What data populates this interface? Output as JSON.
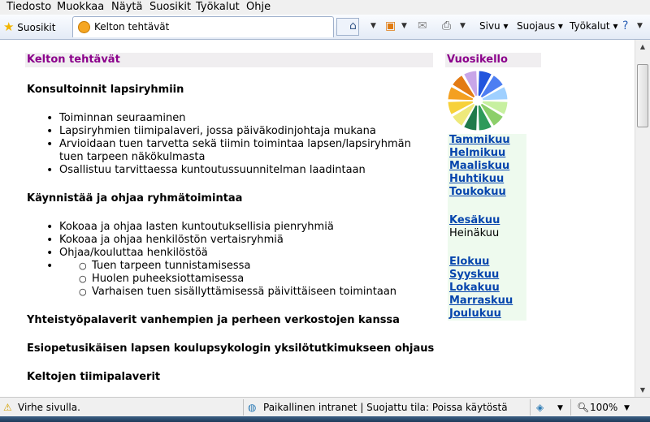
{
  "menu": [
    "Tiedosto",
    "Muokkaa",
    "Näytä",
    "Suosikit",
    "Työkalut",
    "Ohje"
  ],
  "toolbar": {
    "favorites_label": "Suosikit",
    "tab_title": "Kelton tehtävät",
    "page_label": "Sivu",
    "security_label": "Suojaus",
    "tools_label": "Työkalut",
    "icons": [
      "home-icon",
      "rss-icon",
      "mail-icon",
      "print-icon",
      "help-icon"
    ]
  },
  "page": {
    "title": "Kelton tehtävät",
    "sections": [
      {
        "heading": "Konsultoinnit lapsiryhmiin",
        "items": [
          "Toiminnan seuraaminen",
          "Lapsiryhmien tiimipalaveri, jossa päiväkodinjohtaja mukana",
          "Arvioidaan tuen tarvetta sekä tiimin toimintaa lapsen/lapsiryhmän tuen tarpeen näkökulmasta",
          "Osallistuu tarvittaessa kuntoutussuunnitelman laadintaan"
        ]
      },
      {
        "heading": "Käynnistää ja ohjaa ryhmätoimintaa",
        "items": [
          "Kokoaa ja ohjaa lasten kuntoutuksellisia pienryhmiä",
          "Kokoaa ja ohjaa henkilöstön vertaisryhmiä",
          "Ohjaa/kouluttaa henkilöstöä"
        ],
        "subitems": [
          "Tuen tarpeen tunnistamisessa",
          "Huolen puheeksiottamisessa",
          "Varhaisen tuen sisällyttämisessä päivittäiseen toimintaan"
        ]
      },
      {
        "heading": "Yhteistyöpalaverit vanhempien ja perheen verkostojen kanssa"
      },
      {
        "heading": "Esiopetusikäisen lapsen koulupsykologin yksilötutkimukseen ohjaus"
      },
      {
        "heading": "Keltojen tiimipalaverit"
      }
    ]
  },
  "sidebar": {
    "title": "Vuosikello",
    "months": [
      "Tammikuu",
      "Helmikuu",
      "Maaliskuu",
      "Huhtikuu",
      "Toukokuu",
      "Kesäkuu",
      "Heinäkuu",
      "Elokuu",
      "Syyskuu",
      "Lokakuu",
      "Marraskuu",
      "Joulukuu"
    ],
    "current_month": "Heinäkuu",
    "wheel_colors": [
      "#2255dd",
      "#4d7ef2",
      "#9fd0ff",
      "#c7f0a0",
      "#8ccf6a",
      "#2e9a5a",
      "#1f7a4a",
      "#eee97a",
      "#f7d13a",
      "#f4a020",
      "#e37b14",
      "#c8a6e8"
    ]
  },
  "status": {
    "error_text": "Virhe sivulla.",
    "zone_text": "Paikallinen intranet | Suojattu tila: Poissa käytöstä",
    "zoom": "100%"
  }
}
